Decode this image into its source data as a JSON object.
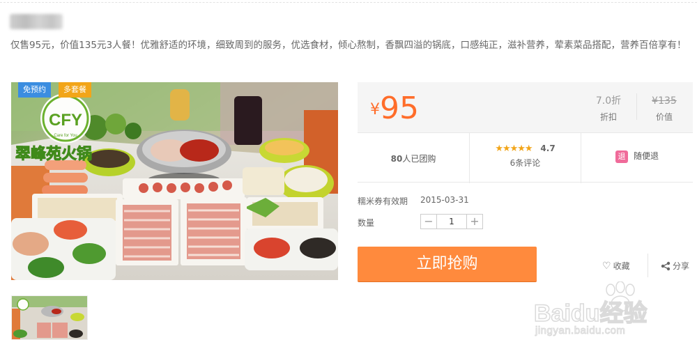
{
  "deal": {
    "description": "仅售95元，价值135元3人餐！优雅舒适的环境，细致周到的服务，优选食材，倾心熬制，香飘四溢的锅底，口感纯正，滋补营养，荤素菜品搭配，营养百倍享有！"
  },
  "image": {
    "tags": [
      "免预约",
      "多套餐"
    ],
    "logo_text": "CFY",
    "logo_slogan": "Care for You",
    "restaurant_name": "翠峰苑火锅"
  },
  "price": {
    "currency": "¥",
    "current": "95",
    "discount_value": "7.0折",
    "discount_label": "折扣",
    "original_value": "¥135",
    "original_label": "价值"
  },
  "stats": {
    "bought_count": "80",
    "bought_suffix": "人已团购",
    "stars": "★★★★★",
    "rating": "4.7",
    "reviews": "6条评论",
    "refund_icon": "退",
    "refund_label": "随便退"
  },
  "details": {
    "expiry_label": "糯米券有效期",
    "expiry_value": "2015-03-31",
    "quantity_label": "数量",
    "quantity_value": "1",
    "minus": "−",
    "plus": "+"
  },
  "actions": {
    "buy_label": "立即抢购",
    "favorite_label": "收藏",
    "favorite_icon": "♡",
    "share_label": "分享"
  },
  "watermark": {
    "brand": "Baidu经验",
    "url": "jingyan.baidu.com"
  },
  "colors": {
    "accent": "#ff8a3d",
    "price": "#ff6d2a",
    "tag_blue": "#3b8de0",
    "tag_orange": "#f2a519",
    "star": "#f2a519",
    "refund_icon": "#f06b9a"
  },
  "icons": [
    "heart-icon",
    "share-icon",
    "refund-icon",
    "minus-icon",
    "plus-icon"
  ]
}
